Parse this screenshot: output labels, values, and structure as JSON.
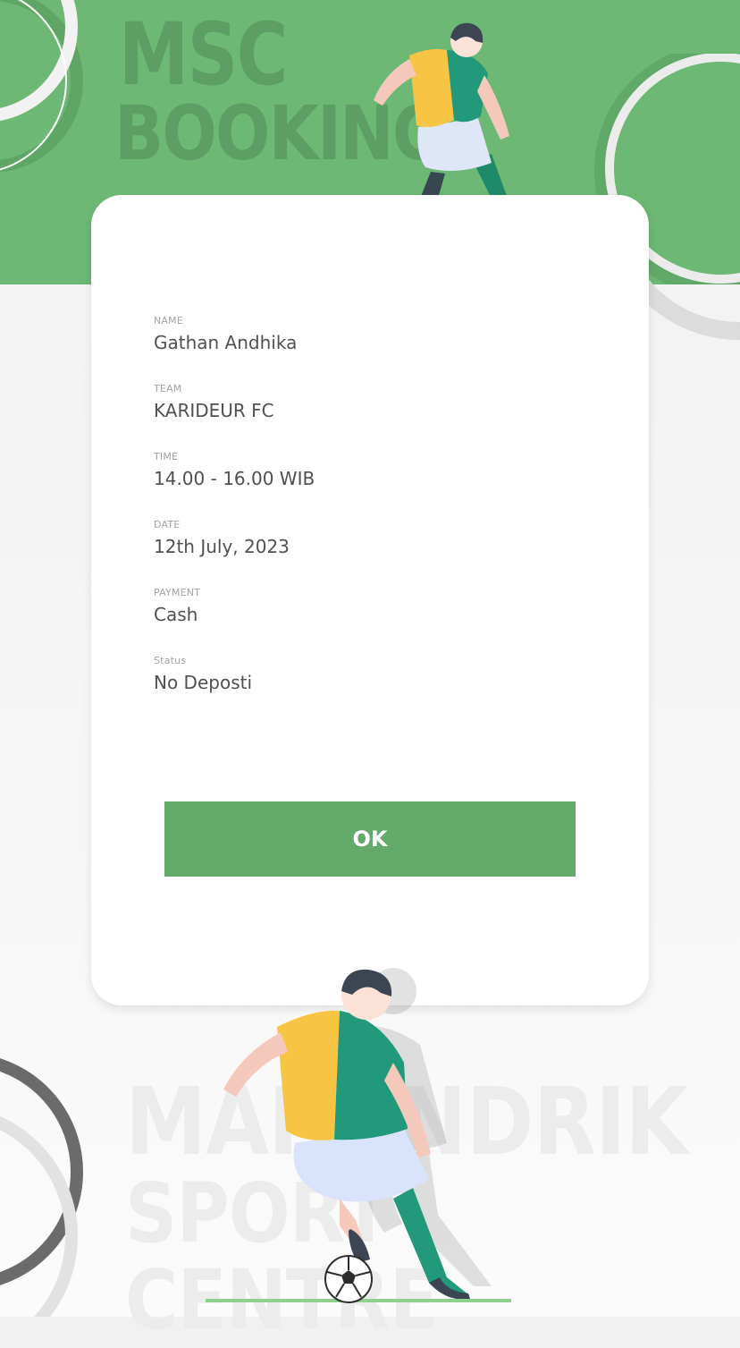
{
  "brand": {
    "line1": "MSC",
    "line2": "BOOKING"
  },
  "booking": {
    "fields": [
      {
        "label": "NAME",
        "value": "Gathan Andhika"
      },
      {
        "label": "TEAM",
        "value": "KARIDEUR FC"
      },
      {
        "label": "TIME",
        "value": "14.00 - 16.00 WIB"
      },
      {
        "label": "DATE",
        "value": "12th July, 2023"
      },
      {
        "label": "PAYMENT",
        "value": "Cash"
      },
      {
        "label": "Status",
        "value": "No Deposti"
      }
    ],
    "ok_label": "OK"
  },
  "footer": {
    "line1": "MAHANDRIK",
    "line2": "SPORT CENTRE"
  },
  "colors": {
    "header_green": "#6cb874",
    "button_green": "#63aa6b",
    "text_dark": "#505050",
    "label_gray": "#a2a2a2"
  },
  "icons": [
    "football-player-illustration",
    "football-player-large-illustration",
    "soccer-ball-icon"
  ]
}
